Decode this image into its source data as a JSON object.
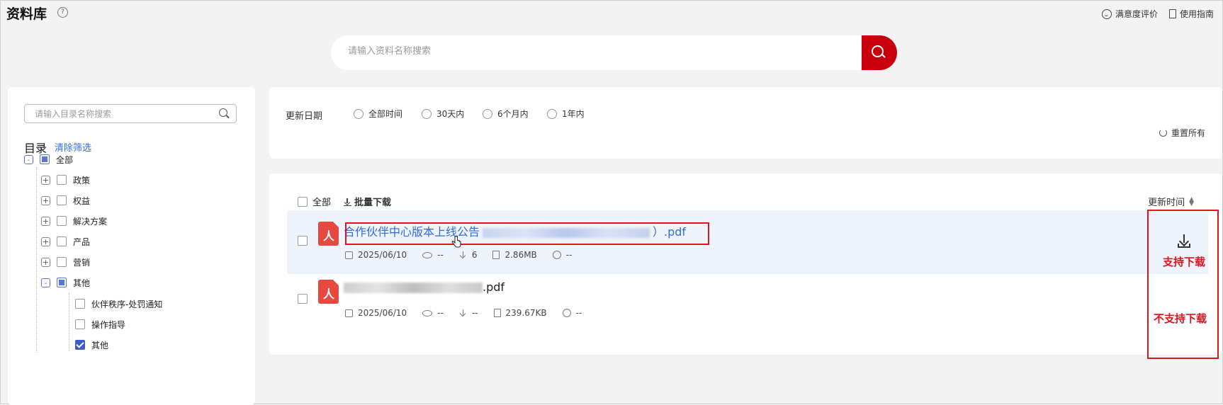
{
  "header": {
    "title": "资料库",
    "help_icon": "question-circle-icon",
    "satisfaction": "满意度评价",
    "guide": "使用指南"
  },
  "search": {
    "placeholder": "请输入资料名称搜索",
    "button_icon": "search-icon"
  },
  "sidebar": {
    "search_placeholder": "请输入目录名称搜索",
    "heading": "目录",
    "clear_filter": "清除筛选",
    "tree": [
      {
        "label": "全部",
        "expander": "-",
        "state": "partial"
      },
      {
        "label": "政策",
        "expander": "+",
        "state": "unchecked"
      },
      {
        "label": "权益",
        "expander": "+",
        "state": "unchecked"
      },
      {
        "label": "解决方案",
        "expander": "+",
        "state": "unchecked"
      },
      {
        "label": "产品",
        "expander": "+",
        "state": "unchecked"
      },
      {
        "label": "营销",
        "expander": "+",
        "state": "unchecked"
      },
      {
        "label": "其他",
        "expander": "-",
        "state": "partial"
      },
      {
        "label": "伙伴秩序-处罚通知",
        "state": "unchecked"
      },
      {
        "label": "操作指导",
        "state": "unchecked"
      },
      {
        "label": "其他",
        "state": "checked"
      }
    ]
  },
  "filter": {
    "label": "更新日期",
    "options": [
      "全部时间",
      "30天内",
      "6个月内",
      "1年内"
    ],
    "reset": "重置所有"
  },
  "list": {
    "select_all": "全部",
    "batch_download": "批量下载",
    "sort_label": "更新时间",
    "items": [
      {
        "name_prefix": "合作伙伴中心版本上线公告",
        "name_suffix": "）.pdf",
        "date": "2025/06/10",
        "views": "--",
        "downloads": "6",
        "size": "2.86MB",
        "rating": "--"
      },
      {
        "name_suffix": ".pdf",
        "date": "2025/06/10",
        "views": "--",
        "downloads": "--",
        "size": "239.67KB",
        "rating": "--"
      }
    ]
  },
  "annotations": {
    "supports_download": "支持下载",
    "no_download": "不支持下载"
  },
  "colors": {
    "brand_red": "#c7000b",
    "link_blue": "#2f6cd8",
    "annotation_red": "#e0141e"
  }
}
